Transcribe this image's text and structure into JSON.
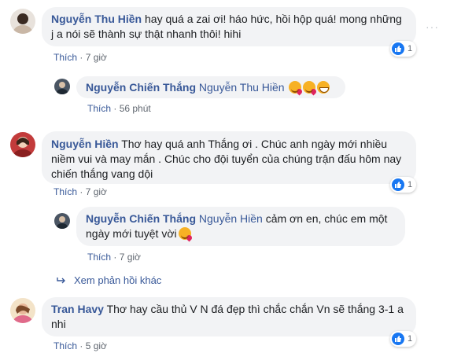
{
  "comments": [
    {
      "author": "Nguyễn Thu Hiền",
      "text": " hay quá a zai ơi! háo hức, hồi hộp quá! mong những j a nói sẽ thành sự thật nhanh thôi! hihi",
      "like_label": "Thích",
      "time": "7 giờ",
      "reaction_count": "1",
      "more_icon": "···"
    },
    {
      "author": "Nguyễn Chiến Thắng",
      "tag": "Nguyễn Thu Hiền",
      "like_label": "Thích",
      "time": "56 phút"
    },
    {
      "author": "Nguyễn Hiền",
      "text": " Thơ hay quá anh Thắng ơi . Chúc anh ngày mới nhiều niềm vui và may mắn . Chúc cho đội tuyển của chúng trận đấu hôm nay chiến thắng vang dội",
      "like_label": "Thích",
      "time": "7 giờ",
      "reaction_count": "1"
    },
    {
      "author": "Nguyễn Chiến Thắng",
      "tag": "Nguyễn Hiền",
      "text": " cảm ơn en, chúc em một ngày mới tuyệt vời",
      "like_label": "Thích",
      "time": "7 giờ"
    },
    {
      "author": "Tran Havy",
      "text": " Thơ hay cầu thủ V N đá đẹp thì chắc chắn Vn sẽ thắng 3-1 a nhi",
      "like_label": "Thích",
      "time": "5 giờ",
      "reaction_count": "1"
    }
  ],
  "more_replies": "Xem phản hồi khác",
  "separator": "·",
  "colors": {
    "link": "#385898",
    "bubble": "#f2f3f5",
    "like": "#1877f2"
  }
}
